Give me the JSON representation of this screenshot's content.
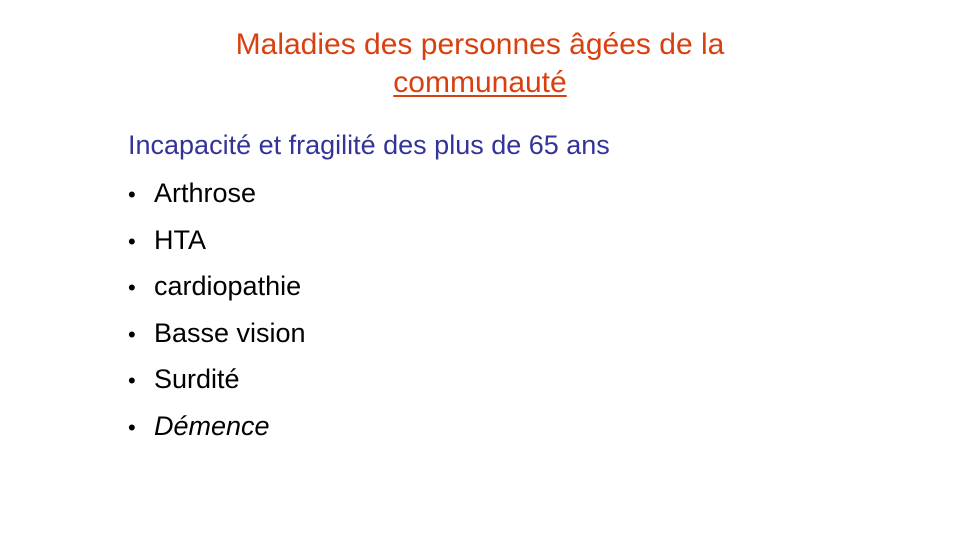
{
  "slide": {
    "title_line1": "Maladies des personnes âgées de la",
    "title_line2": "communauté",
    "subtitle": "Incapacité et fragilité des plus de 65 ans",
    "bullet_symbol": "•",
    "bullets": [
      {
        "text": "Arthrose"
      },
      {
        "text": "HTA"
      },
      {
        "text": "cardiopathie"
      },
      {
        "text": "Basse vision"
      },
      {
        "text": "Surdité"
      },
      {
        "text": "Démence",
        "italic": true
      }
    ],
    "colors": {
      "title": "#d9400f",
      "subtitle": "#333399",
      "body": "#000000",
      "background": "#ffffff"
    }
  }
}
